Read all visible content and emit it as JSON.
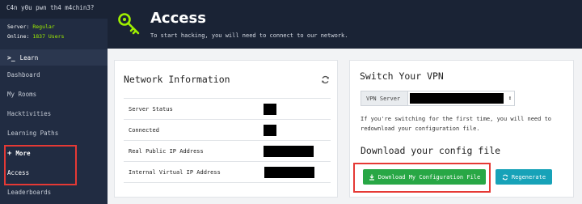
{
  "sidebar": {
    "brand": "C4n y0u pwn th4 m4chin3?",
    "server_label": "Server:",
    "server_value": "Regular",
    "online_label": "Online:",
    "online_value": "1837 Users",
    "learn_label": "Learn",
    "items": [
      {
        "label": "Dashboard"
      },
      {
        "label": "My Rooms"
      },
      {
        "label": "Hacktivities"
      },
      {
        "label": "Learning Paths"
      }
    ],
    "more_label": "More",
    "access_label": "Access",
    "leaderboards_label": "Leaderboards"
  },
  "header": {
    "title": "Access",
    "subtitle": "To start hacking, you will need to connect to our network."
  },
  "network": {
    "title": "Network Information",
    "rows": [
      {
        "label": "Server Status"
      },
      {
        "label": "Connected"
      },
      {
        "label": "Real Public IP Address"
      },
      {
        "label": "Internal Virtual IP Address"
      }
    ]
  },
  "vpn": {
    "title": "Switch Your VPN",
    "server_label": "VPN Server",
    "description": "If you're switching for the first time, you will need to redownload your configuration file.",
    "download_title": "Download your config file",
    "download_button": "Download My Configuration File",
    "regenerate_button": "Regenerate"
  },
  "colors": {
    "sidebar_bg": "#212c42",
    "header_bg": "#1a2335",
    "accent_green": "#9fef00",
    "download_green": "#28a745",
    "regenerate_teal": "#17a2b8",
    "highlight_red": "#e53935"
  }
}
